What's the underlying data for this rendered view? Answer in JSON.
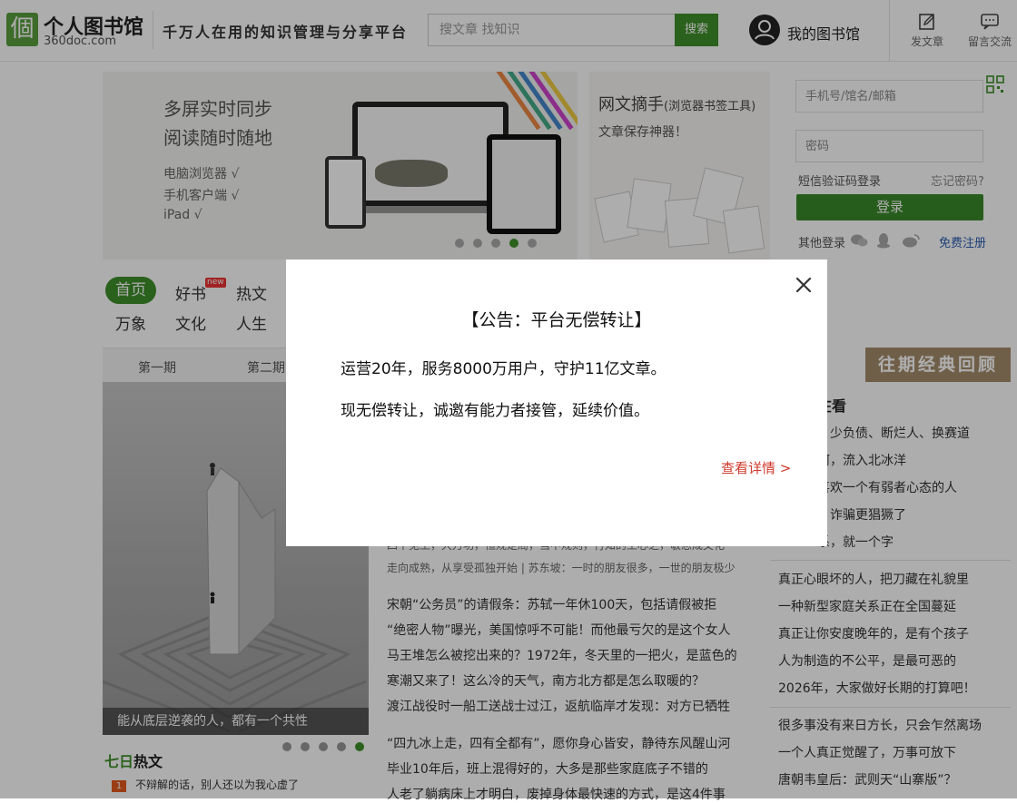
{
  "header": {
    "logo_char": "個",
    "logo_name": "个人图书馆",
    "logo_domain": "360doc.com",
    "slogan": "千万人在用的知识管理与分享平台",
    "search_placeholder": "搜文章 找知识",
    "search_button": "搜索",
    "my_library": "我的图书馆",
    "post_article": "发文章",
    "messages": "留言交流"
  },
  "banner1": {
    "title_line1": "多屏实时同步",
    "title_line2": "阅读随时随地",
    "items": [
      "电脑浏览器 √",
      "手机客户端 √",
      "iPad √"
    ]
  },
  "banner2": {
    "title": "网文摘手",
    "title_sub": "(浏览器书签工具)",
    "subtitle": "文章保存神器！"
  },
  "login": {
    "username_placeholder": "手机号/馆名/邮箱",
    "password_placeholder": "密码",
    "sms_login": "短信验证码登录",
    "forgot": "忘记密码?",
    "login_button": "登录",
    "other_login": "其他登录",
    "register": "免费注册"
  },
  "nav": {
    "row1": [
      "首页",
      "好书",
      "热文"
    ],
    "row2": [
      "万象",
      "文化",
      "人生"
    ],
    "new_badge": "new"
  },
  "issues": {
    "tabs": [
      "第一期",
      "第二期"
    ],
    "right_partial": "期"
  },
  "feature": {
    "caption": "能从底层逆袭的人，都有一个共性"
  },
  "hot": {
    "title_a": "七日",
    "title_b": "热文",
    "rank1_num": "1",
    "rank1_text": "不辩解的话，别人还以为我心虚了"
  },
  "middle": {
    "partial_line": "四个见工，大万功，恒规定局，当中规则，行知的工心之，敏思成文化",
    "small_line": "走向成熟，从享受孤独开始 | 苏东坡：一时的朋友很多，一世的朋友极少",
    "group1": [
      "宋朝“公务员”的请假条：苏轼一年休100天，包括请假被拒",
      "“绝密人物”曝光，美国惊呼不可能！而他最亏欠的是这个女人",
      "马王堆怎么被挖出来的？1972年，冬天里的一把火，是蓝色的",
      "寒潮又来了！这么冷的天气，南方北方都是怎么取暖的？",
      "渡江战役时一船工送战士过江，返航临岸才发现：对方已牺牲"
    ],
    "group2": [
      "“四九冰上走，四有全都有”，愿你身心皆安，静待东风醒山河",
      "毕业10年后，班上混得好的，大多是那些家庭底子不错的",
      "人老了躺病床上才明白，废掉身体最快速的方式，是这4件事"
    ]
  },
  "right": {
    "banner": "往期经典回顾",
    "partial_tab": "期",
    "heading_partial": "在看",
    "partial_lines": [
      "，少负债、断烂人、换赛道",
      "河，流入北冰洋",
      "喜欢一个有弱者心态的人",
      "，诈骗更猖獗了",
      "系，就一个字"
    ],
    "group1": [
      "真正心眼坏的人，把刀藏在礼貌里",
      "一种新型家庭关系正在全国蔓延",
      "真正让你安度晚年的，是有个孩子",
      "人为制造的不公平，是最可恶的",
      "2026年，大家做好长期的打算吧！"
    ],
    "group2": [
      "很多事没有来日方长，只会乍然离场",
      "一个人真正觉醒了，万事可放下",
      "唐朝韦皇后：武则天“山寨版”？"
    ]
  },
  "modal": {
    "title": "【公告：平台无偿转让】",
    "line1": "运营20年，服务8000万用户，守护11亿文章。",
    "line2": "现无偿转让，诚邀有能力者接管，延续价值。",
    "link": "查看详情 >"
  },
  "colors": {
    "brand_green": "#3f8f2a",
    "link_red": "#d0392b",
    "overlay": "rgba(0,0,0,0.32)"
  }
}
